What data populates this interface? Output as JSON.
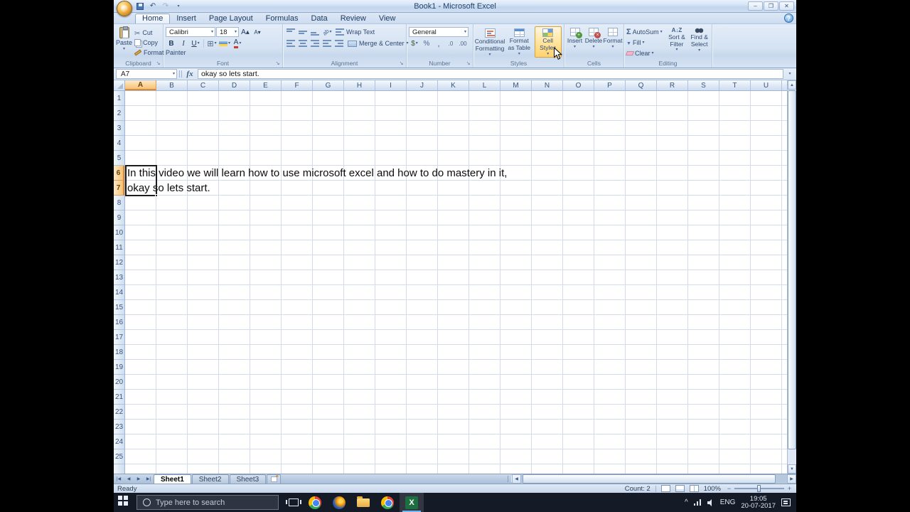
{
  "window": {
    "title": "Book1 - Microsoft Excel"
  },
  "ribbon": {
    "tabs": [
      "Home",
      "Insert",
      "Page Layout",
      "Formulas",
      "Data",
      "Review",
      "View"
    ],
    "active_tab": "Home",
    "clipboard": {
      "label": "Clipboard",
      "paste": "Paste",
      "cut": "Cut",
      "copy": "Copy",
      "format_painter": "Format Painter"
    },
    "font": {
      "label": "Font",
      "name": "Calibri",
      "size": "18"
    },
    "alignment": {
      "label": "Alignment",
      "wrap_text": "Wrap Text",
      "merge_center": "Merge & Center"
    },
    "number": {
      "label": "Number",
      "format": "General"
    },
    "styles": {
      "label": "Styles",
      "conditional": "Conditional Formatting",
      "format_table": "Format as Table",
      "cell_styles": "Cell Styles"
    },
    "cells": {
      "label": "Cells",
      "insert": "Insert",
      "delete": "Delete",
      "format": "Format"
    },
    "editing": {
      "label": "Editing",
      "autosum": "AutoSum",
      "fill": "Fill",
      "clear": "Clear",
      "sort_filter": "Sort & Filter",
      "find_select": "Find & Select"
    },
    "help_label": "?"
  },
  "formula_bar": {
    "name_box": "A7",
    "fx_label": "fx",
    "value": "okay so lets start."
  },
  "grid": {
    "columns": [
      "A",
      "B",
      "C",
      "D",
      "E",
      "F",
      "G",
      "H",
      "I",
      "J",
      "K",
      "L",
      "M",
      "N",
      "O",
      "P",
      "Q",
      "R",
      "S",
      "T",
      "U"
    ],
    "row_count": 25,
    "selected_columns": [
      "A"
    ],
    "selected_rows": [
      6,
      7
    ],
    "selection": {
      "range": "A6:A7",
      "active_cell": "A7"
    },
    "cells": [
      {
        "row": 6,
        "col": "A",
        "text": "In this video we will learn how to use microsoft excel and how to do mastery in it,"
      },
      {
        "row": 7,
        "col": "A",
        "text": "okay so lets start."
      }
    ]
  },
  "sheets": {
    "tabs": [
      "Sheet1",
      "Sheet2",
      "Sheet3"
    ],
    "active": "Sheet1"
  },
  "status": {
    "mode": "Ready",
    "count": "Count: 2",
    "zoom": "100%"
  },
  "taskbar": {
    "search_placeholder": "Type here to search",
    "language": "ENG",
    "time": "19:05",
    "date": "20-07-2017"
  },
  "colors": {
    "header_selection": "#f5c276",
    "ribbon_hover": "#ffd26c",
    "excel_brand": "#1d6f42",
    "taskbar_bg": "#151b26"
  }
}
